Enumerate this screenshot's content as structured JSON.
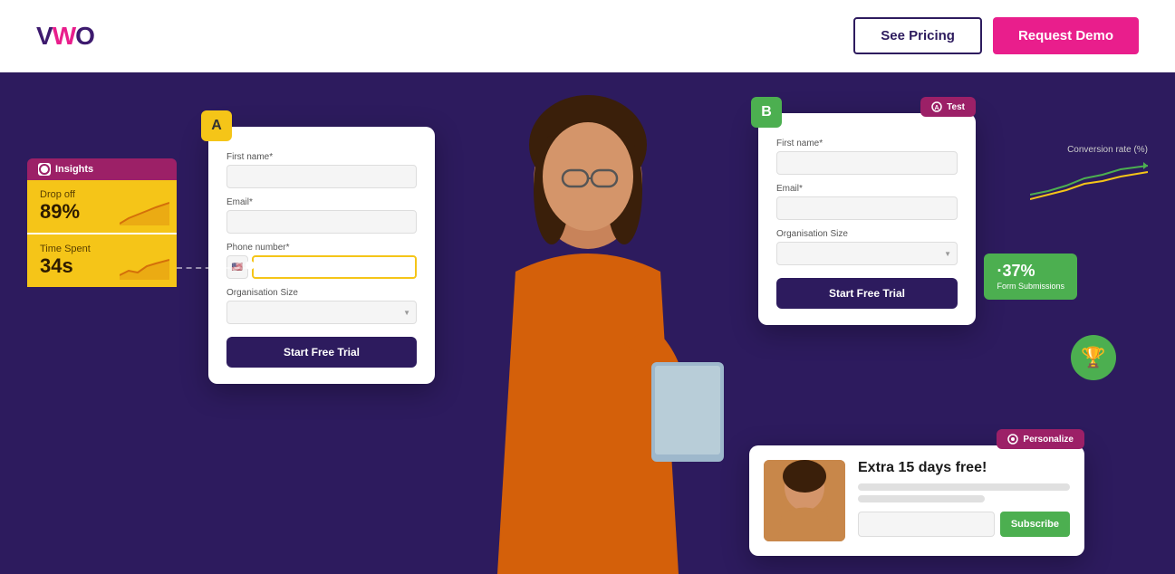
{
  "header": {
    "logo_text": "VWO",
    "see_pricing_label": "See Pricing",
    "request_demo_label": "Request Demo"
  },
  "insights": {
    "section_label": "Insights",
    "dropoff_label": "Drop off",
    "dropoff_value": "89%",
    "time_spent_label": "Time Spent",
    "time_spent_value": "34s"
  },
  "form_a": {
    "badge": "A",
    "first_name_label": "First name*",
    "email_label": "Email*",
    "phone_label": "Phone number*",
    "org_label": "Organisation Size",
    "cta": "Start Free Trial"
  },
  "form_b": {
    "badge": "B",
    "test_badge": "Test",
    "first_name_label": "First name*",
    "email_label": "Email*",
    "org_label": "Organisation Size",
    "cta": "Start Free Trial"
  },
  "conversion": {
    "label": "Conversion rate (%)"
  },
  "green_badge": {
    "value": "·37%",
    "sublabel": "Form Submissions"
  },
  "personalize": {
    "badge": "Personalize",
    "title": "Extra 15 days free!",
    "subscribe_placeholder": "",
    "subscribe_label": "Subscribe"
  }
}
